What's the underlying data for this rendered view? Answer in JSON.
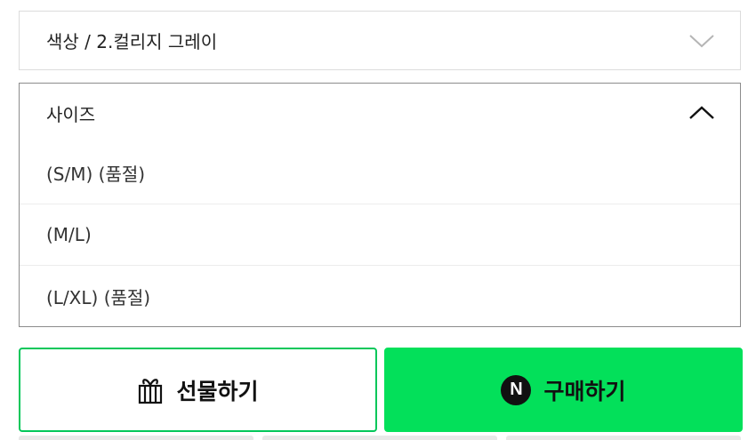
{
  "color_select": {
    "value": "색상 / 2.컬리지 그레이",
    "icon": "chevron-down-icon"
  },
  "size_select": {
    "label": "사이즈",
    "icon": "chevron-up-icon",
    "options": [
      {
        "label": "(S/M) (품절)"
      },
      {
        "label": "(M/L)"
      },
      {
        "label": "(L/XL) (품절)"
      }
    ]
  },
  "actions": {
    "gift_label": "선물하기",
    "gift_icon": "gift-icon",
    "buy_label": "구매하기",
    "buy_icon": "naver-n-icon",
    "buy_icon_letter": "N"
  },
  "colors": {
    "accent_green": "#03e05a",
    "gift_border": "#03c75a"
  }
}
